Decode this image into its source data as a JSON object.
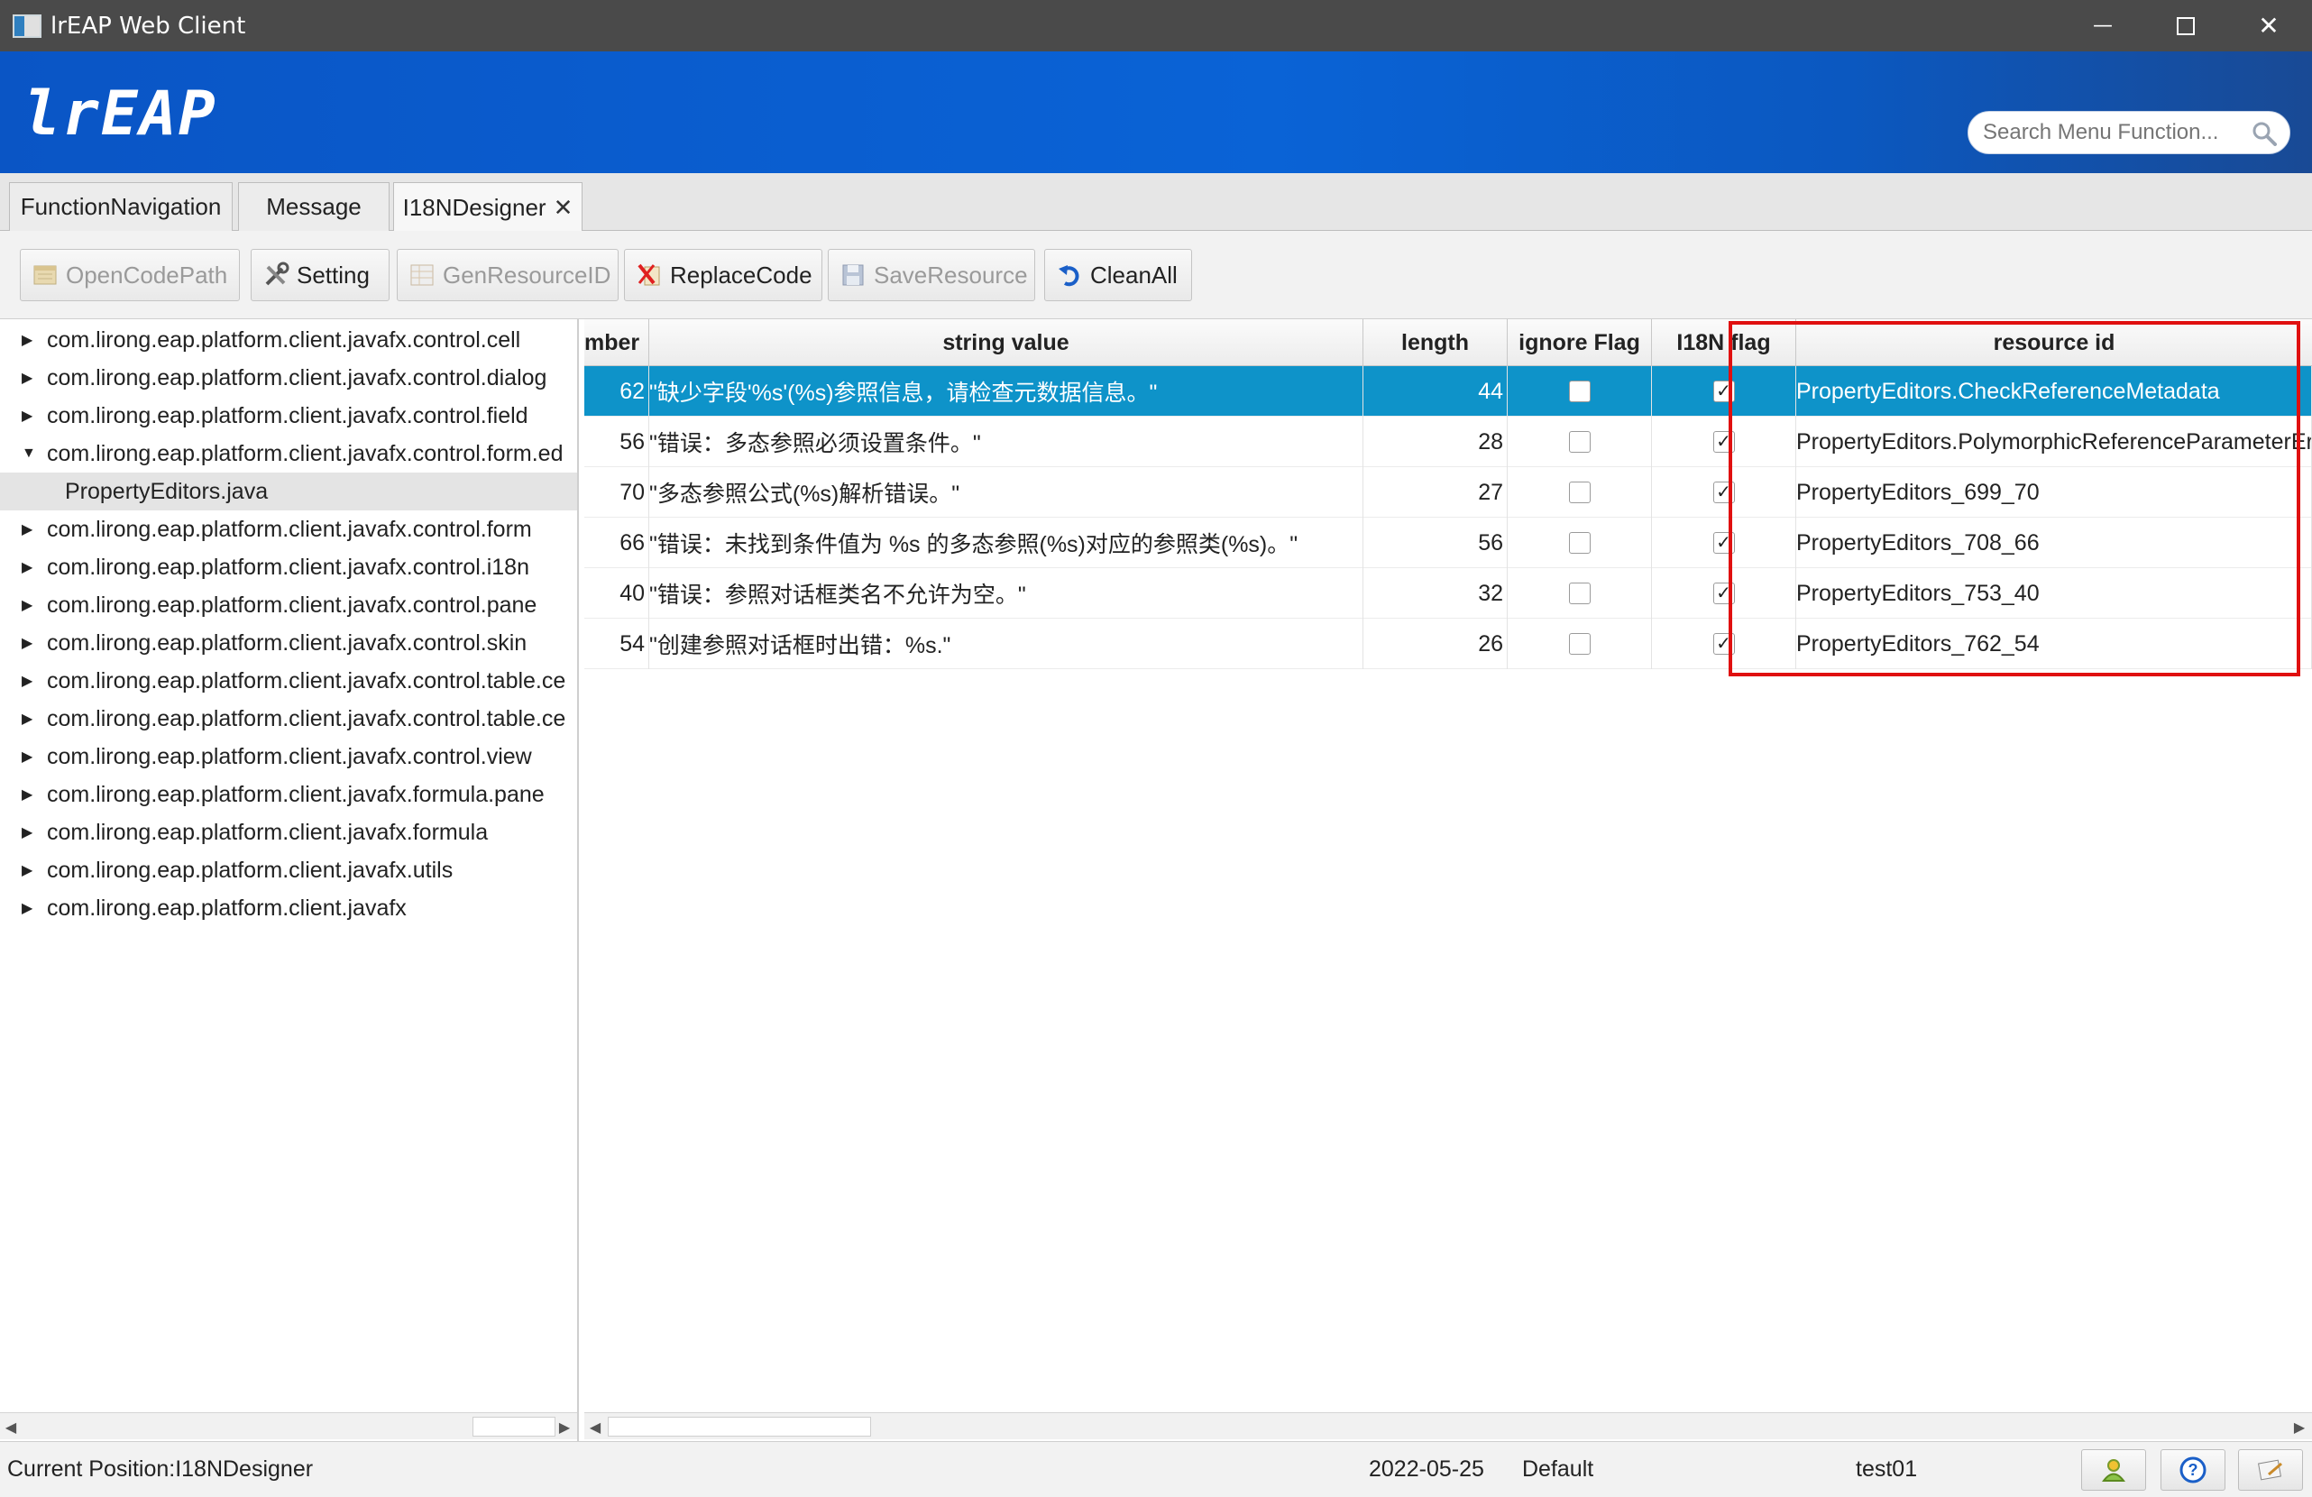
{
  "window": {
    "title": "lrEAP Web Client",
    "minimize_label": "—",
    "close_label": "✕"
  },
  "banner": {
    "logo": "lrEAP",
    "search_placeholder": "Search Menu Function..."
  },
  "tabs": [
    {
      "label": "FunctionNavigation"
    },
    {
      "label": "Message"
    },
    {
      "label": "I18NDesigner",
      "close": "✕",
      "active": true
    }
  ],
  "toolbar": {
    "buttons": [
      {
        "label": "OpenCodePath",
        "icon": "folder-icon",
        "enabled": false
      },
      {
        "label": "Setting",
        "icon": "tools-icon",
        "enabled": true
      },
      {
        "label": "GenResourceID",
        "icon": "grid-icon",
        "enabled": false
      },
      {
        "label": "ReplaceCode",
        "icon": "replace-icon",
        "enabled": true
      },
      {
        "label": "SaveResource",
        "icon": "save-icon",
        "enabled": false
      },
      {
        "label": "CleanAll",
        "icon": "undo-icon",
        "enabled": true
      }
    ]
  },
  "tree": {
    "items": [
      {
        "label": "com.lirong.eap.platform.client.javafx.control.cell",
        "arrow": "▶"
      },
      {
        "label": "com.lirong.eap.platform.client.javafx.control.dialog",
        "arrow": "▶"
      },
      {
        "label": "com.lirong.eap.platform.client.javafx.control.field",
        "arrow": "▶"
      },
      {
        "label": "com.lirong.eap.platform.client.javafx.control.form.ed",
        "arrow": "▼"
      },
      {
        "label": "PropertyEditors.java",
        "arrow": ""
      },
      {
        "label": "com.lirong.eap.platform.client.javafx.control.form",
        "arrow": "▶"
      },
      {
        "label": "com.lirong.eap.platform.client.javafx.control.i18n",
        "arrow": "▶"
      },
      {
        "label": "com.lirong.eap.platform.client.javafx.control.pane",
        "arrow": "▶"
      },
      {
        "label": "com.lirong.eap.platform.client.javafx.control.skin",
        "arrow": "▶"
      },
      {
        "label": "com.lirong.eap.platform.client.javafx.control.table.ce",
        "arrow": "▶"
      },
      {
        "label": "com.lirong.eap.platform.client.javafx.control.table.ce",
        "arrow": "▶"
      },
      {
        "label": "com.lirong.eap.platform.client.javafx.control.view",
        "arrow": "▶"
      },
      {
        "label": "com.lirong.eap.platform.client.javafx.formula.pane",
        "arrow": "▶"
      },
      {
        "label": "com.lirong.eap.platform.client.javafx.formula",
        "arrow": "▶"
      },
      {
        "label": "com.lirong.eap.platform.client.javafx.utils",
        "arrow": "▶"
      },
      {
        "label": "com.lirong.eap.platform.client.javafx",
        "arrow": "▶"
      }
    ]
  },
  "table": {
    "columns": [
      "mber",
      "string value",
      "length",
      "ignore Flag",
      "I18N flag",
      "resource id"
    ],
    "rows": [
      {
        "number": "62",
        "value": "\"缺少字段'%s'(%s)参照信息，请检查元数据信息。\"",
        "length": "44",
        "ignore": false,
        "i18n": true,
        "resource_id": "PropertyEditors.CheckReferenceMetadata",
        "selected": true
      },
      {
        "number": "56",
        "value": "\"错误：多态参照必须设置条件。\"",
        "length": "28",
        "ignore": false,
        "i18n": true,
        "resource_id": "PropertyEditors.PolymorphicReferenceParameterError",
        "selected": false
      },
      {
        "number": "70",
        "value": "\"多态参照公式(%s)解析错误。\"",
        "length": "27",
        "ignore": false,
        "i18n": true,
        "resource_id": "PropertyEditors_699_70",
        "selected": false
      },
      {
        "number": "66",
        "value": "\"错误：未找到条件值为 %s 的多态参照(%s)对应的参照类(%s)。\"",
        "length": "56",
        "ignore": false,
        "i18n": true,
        "resource_id": "PropertyEditors_708_66",
        "selected": false
      },
      {
        "number": "40",
        "value": "\"错误：参照对话框类名不允许为空。\"",
        "length": "32",
        "ignore": false,
        "i18n": true,
        "resource_id": "PropertyEditors_753_40",
        "selected": false
      },
      {
        "number": "54",
        "value": "\"创建参照对话框时出错：%s.\"",
        "length": "26",
        "ignore": false,
        "i18n": true,
        "resource_id": "PropertyEditors_762_54",
        "selected": false
      }
    ]
  },
  "status": {
    "position": "Current Position:I18NDesigner",
    "date": "2022-05-25",
    "profile": "Default",
    "user": "test01"
  },
  "colors": {
    "banner": "#0a5fd0",
    "selection": "#0e93c9",
    "highlight": "#e01010"
  }
}
